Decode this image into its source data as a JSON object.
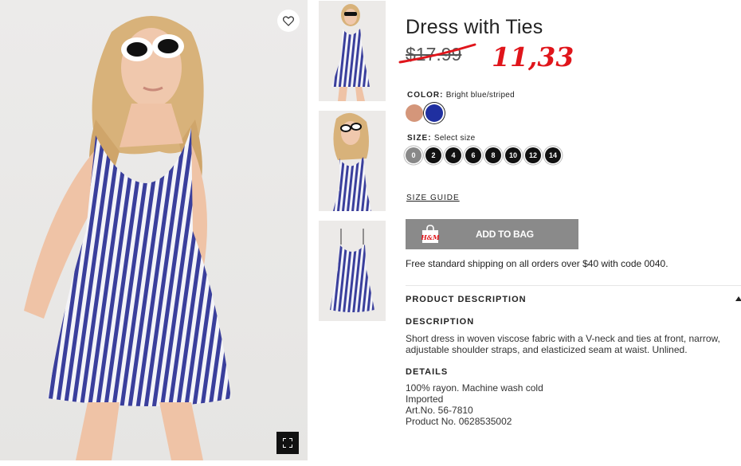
{
  "product": {
    "title": "Dress with Ties",
    "old_price": "$17.99",
    "new_price": "11,33"
  },
  "color": {
    "label": "COLOR:",
    "value": "Bright blue/striped",
    "swatches": [
      {
        "name": "powder-pink",
        "hex": "#d4967a"
      },
      {
        "name": "bright-blue-striped",
        "hex": "#1f2fa0"
      }
    ]
  },
  "size": {
    "label": "SIZE:",
    "value": "Select size",
    "options": [
      "0",
      "2",
      "4",
      "6",
      "8",
      "10",
      "12",
      "14"
    ]
  },
  "size_guide": "SIZE GUIDE",
  "add_to_bag": "ADD TO BAG",
  "bag_logo": "H&M",
  "shipping": "Free standard shipping on all orders over $40 with code 0040.",
  "product_description": {
    "header": "PRODUCT DESCRIPTION",
    "description_title": "DESCRIPTION",
    "description_text": "Short dress in woven viscose fabric with a V-neck and ties at front, narrow, adjustable shoulder straps, and elasticized seam at waist. Unlined.",
    "details_title": "DETAILS",
    "details": [
      "100% rayon. Machine wash cold",
      "Imported",
      "Art.No. 56-7810",
      "Product No. 0628535002"
    ]
  },
  "icons": {
    "favorite": "heart-icon",
    "fullscreen": "expand-icon",
    "bag": "shopping-bag-icon"
  },
  "colors": {
    "button_gray": "#8a8a8a",
    "price_red": "#e0151b",
    "stripe_blue": "#3a3f9c"
  }
}
